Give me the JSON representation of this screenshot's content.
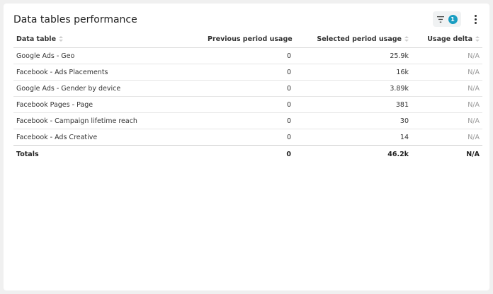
{
  "widget": {
    "title": "Data tables performance",
    "filter_count": "1",
    "accent_color": "#1a9ec2"
  },
  "table": {
    "headers": {
      "data_table": "Data table",
      "previous": "Previous period usage",
      "selected": "Selected period usage",
      "delta": "Usage delta"
    },
    "rows": [
      {
        "name": "Google Ads - Geo",
        "previous": "0",
        "selected": "25.9k",
        "delta": "N/A"
      },
      {
        "name": "Facebook - Ads Placements",
        "previous": "0",
        "selected": "16k",
        "delta": "N/A"
      },
      {
        "name": "Google Ads - Gender by device",
        "previous": "0",
        "selected": "3.89k",
        "delta": "N/A"
      },
      {
        "name": "Facebook Pages - Page",
        "previous": "0",
        "selected": "381",
        "delta": "N/A"
      },
      {
        "name": "Facebook - Campaign lifetime reach",
        "previous": "0",
        "selected": "30",
        "delta": "N/A"
      },
      {
        "name": "Facebook - Ads Creative",
        "previous": "0",
        "selected": "14",
        "delta": "N/A"
      }
    ],
    "totals": {
      "label": "Totals",
      "previous": "0",
      "selected": "46.2k",
      "delta": "N/A"
    }
  },
  "icons": {
    "filter": "filter-icon",
    "more": "more-vertical-icon",
    "sort": "sort-icon"
  }
}
